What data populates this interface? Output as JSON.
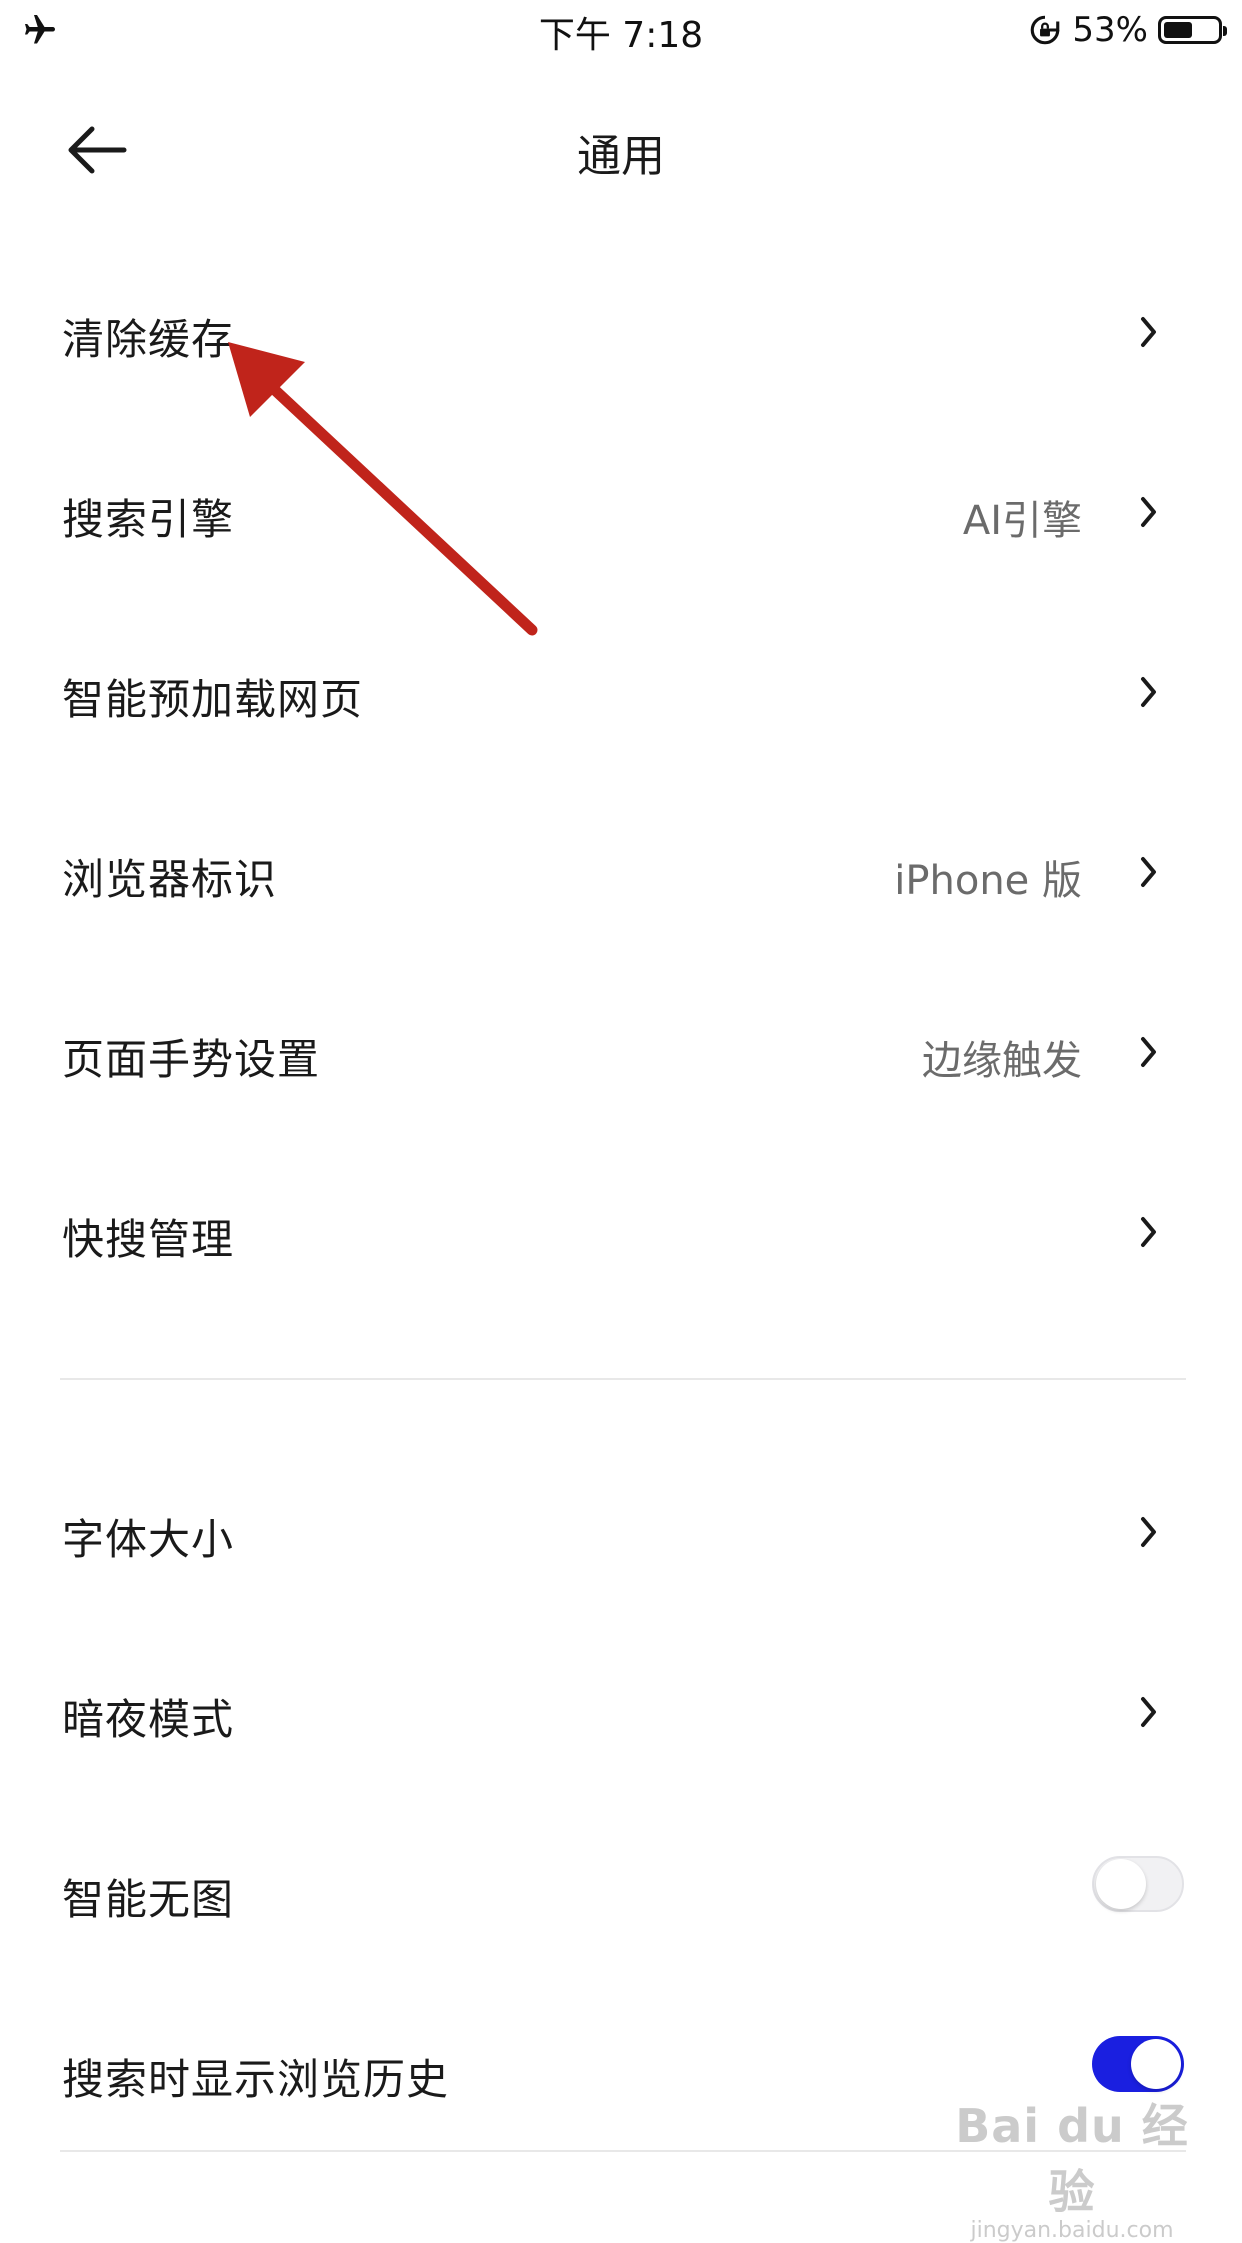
{
  "status_bar": {
    "left_icon": "airplane-icon",
    "time": "下午 7:18",
    "rotation_lock_icon": "rotation-lock-icon",
    "battery_percent": "53%",
    "battery_level": 0.53
  },
  "nav": {
    "back_icon": "arrow-left-icon",
    "title": "通用"
  },
  "settings": {
    "group1": [
      {
        "label": "清除缓存",
        "value": "",
        "type": "link"
      },
      {
        "label": "搜索引擎",
        "value": "AI引擎",
        "type": "link"
      },
      {
        "label": "智能预加载网页",
        "value": "",
        "type": "link"
      },
      {
        "label": "浏览器标识",
        "value": "iPhone 版",
        "type": "link"
      },
      {
        "label": "页面手势设置",
        "value": "边缘触发",
        "type": "link"
      },
      {
        "label": "快搜管理",
        "value": "",
        "type": "link"
      }
    ],
    "group2": [
      {
        "label": "字体大小",
        "value": "",
        "type": "link"
      },
      {
        "label": "暗夜模式",
        "value": "",
        "type": "link"
      },
      {
        "label": "智能无图",
        "type": "toggle",
        "on": false
      },
      {
        "label": "搜索时显示浏览历史",
        "type": "toggle",
        "on": true
      }
    ]
  },
  "colors": {
    "toggle_on": "#1a1fe0",
    "annotation_arrow": "#c0241b",
    "value_text": "#6b6b6b"
  },
  "watermark": {
    "main": "Bai du 经验",
    "sub": "jingyan.baidu.com"
  }
}
